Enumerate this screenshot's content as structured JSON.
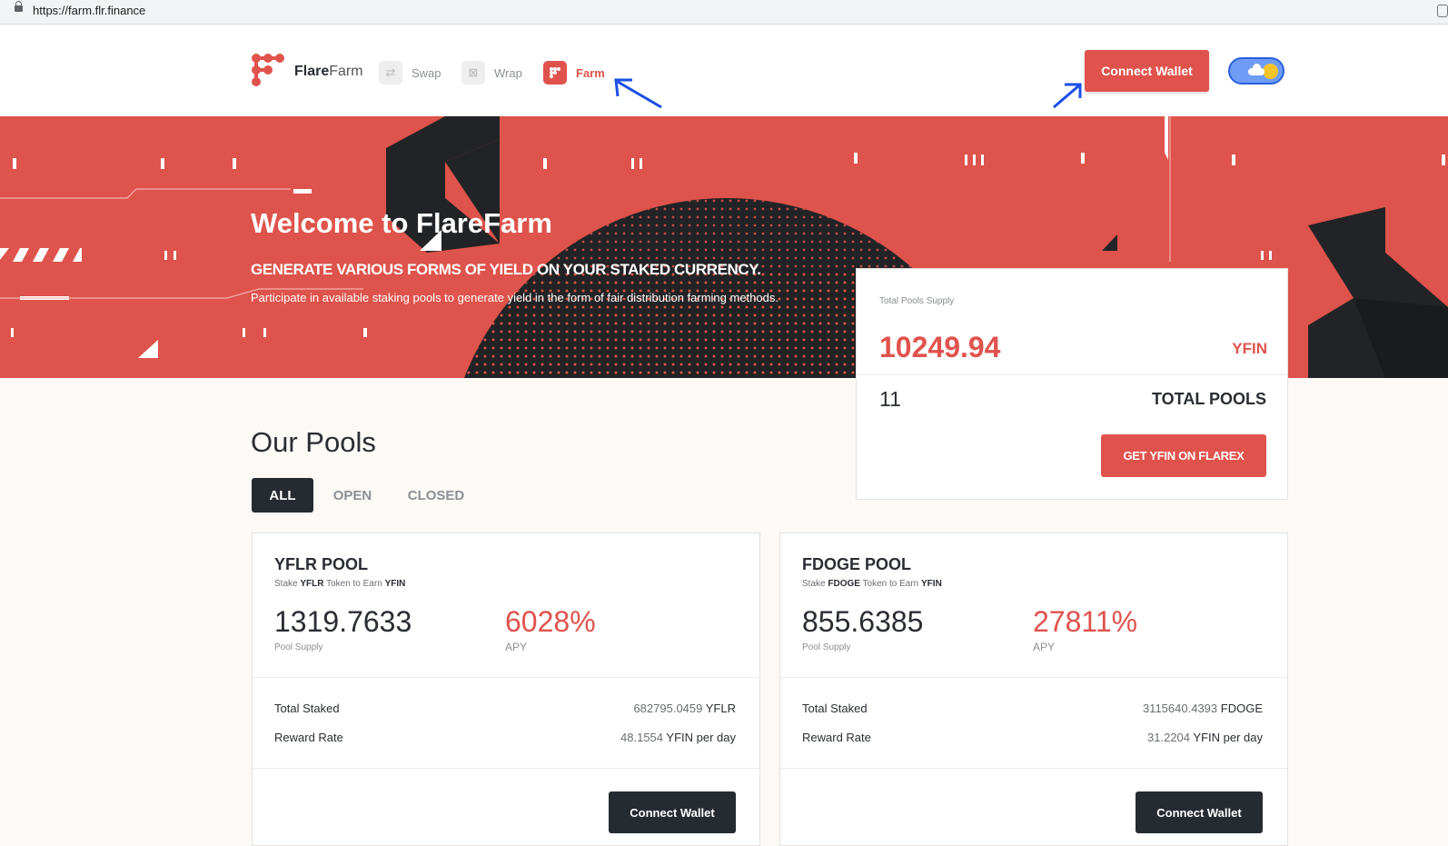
{
  "browser": {
    "url": "https://farm.flr.finance"
  },
  "header": {
    "brand_bold": "Flare",
    "brand_light": "Farm",
    "nav": [
      {
        "label": "Swap",
        "icon": "swap-icon"
      },
      {
        "label": "Wrap",
        "icon": "wrap-icon"
      },
      {
        "label": "Farm",
        "icon": "farm-icon"
      }
    ],
    "connect_label": "Connect Wallet"
  },
  "hero": {
    "title": "Welcome to FlareFarm",
    "subtitle": "GENERATE VARIOUS FORMS OF YIELD ON YOUR STAKED CURRENCY.",
    "description": "Participate in available staking pools to generate yield in the form of fair distribution farming methods."
  },
  "stats": {
    "label": "Total Pools Supply",
    "value": "10249.94",
    "unit": "YFIN",
    "pool_count": "11",
    "pool_count_label": "TOTAL POOLS",
    "button_label": "GET YFIN ON FLAREX"
  },
  "pools_section": {
    "title": "Our Pools",
    "tabs": [
      "ALL",
      "OPEN",
      "CLOSED"
    ]
  },
  "pools": [
    {
      "name": "YFLR POOL",
      "desc_prefix": "Stake ",
      "desc_token": "YFLR",
      "desc_mid": " Token to Earn ",
      "desc_reward": "YFIN",
      "supply": "1319.7633",
      "supply_label": "Pool Supply",
      "apy": "6028%",
      "apy_label": "APY",
      "total_staked_label": "Total Staked",
      "total_staked_value": "682795.0459",
      "total_staked_unit": "YFLR",
      "reward_rate_label": "Reward Rate",
      "reward_rate_value": "48.1554",
      "reward_rate_unit": "YFIN per day",
      "button_label": "Connect Wallet"
    },
    {
      "name": "FDOGE POOL",
      "desc_prefix": "Stake ",
      "desc_token": "FDOGE",
      "desc_mid": " Token to Earn ",
      "desc_reward": "YFIN",
      "supply": "855.6385",
      "supply_label": "Pool Supply",
      "apy": "27811%",
      "apy_label": "APY",
      "total_staked_label": "Total Staked",
      "total_staked_value": "3115640.4393",
      "total_staked_unit": "FDOGE",
      "reward_rate_label": "Reward Rate",
      "reward_rate_value": "31.2204",
      "reward_rate_unit": "YFIN per day",
      "button_label": "Connect Wallet"
    }
  ],
  "colors": {
    "accent": "#e0534d",
    "dark": "#262a31",
    "annotation_arrow": "#1a4ee6"
  }
}
